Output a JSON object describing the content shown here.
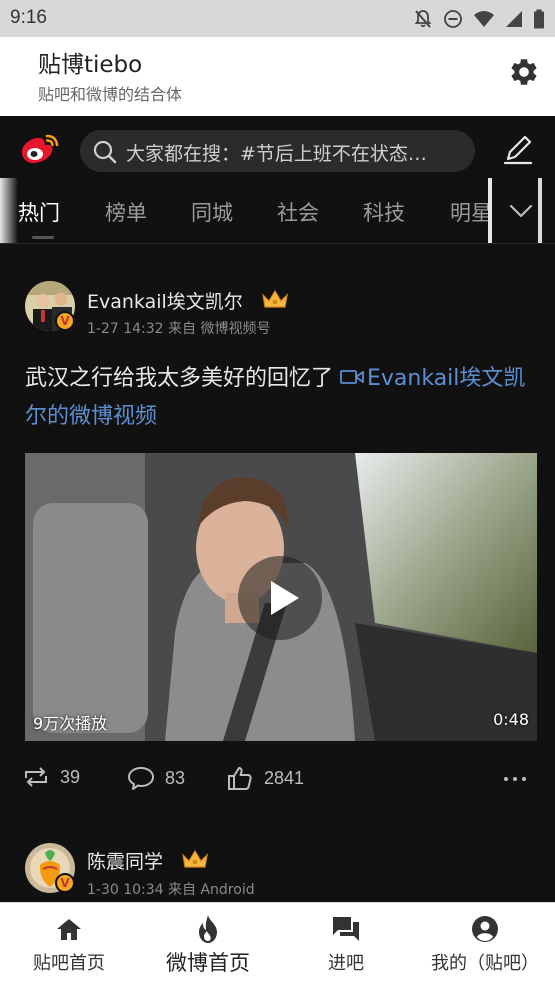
{
  "status_bar": {
    "time": "9:16",
    "icons": [
      "notifications-off-icon",
      "do-not-disturb-icon",
      "wifi-icon",
      "signal-icon",
      "battery-icon"
    ]
  },
  "app_header": {
    "title": "贴博tiebo",
    "subtitle": "贴吧和微博的结合体",
    "settings_icon": "gear-icon"
  },
  "weibo_bar": {
    "logo_icon": "weibo-logo-icon",
    "search_text": "大家都在搜：#节后上班不在状态…",
    "compose_icon": "compose-icon"
  },
  "tabs": {
    "items": [
      {
        "label": "热门",
        "active": true
      },
      {
        "label": "榜单",
        "active": false
      },
      {
        "label": "同城",
        "active": false
      },
      {
        "label": "社会",
        "active": false
      },
      {
        "label": "科技",
        "active": false
      },
      {
        "label": "明星",
        "active": false
      }
    ],
    "more_icon": "chevron-down-icon"
  },
  "posts": [
    {
      "author": "Evankail埃文凯尔",
      "meta": "1-27 14:32 来自 微博视频号",
      "text": "武汉之行给我太多美好的回忆了 ",
      "link_text": "Evankail埃文凯尔的微博视频",
      "video": {
        "play_count": "9万次播放",
        "duration": "0:48"
      },
      "actions": {
        "reposts": "39",
        "comments": "83",
        "likes": "2841"
      }
    },
    {
      "author": "陈震同学",
      "meta": "1-30 10:34 来自 Android"
    }
  ],
  "bottom_nav": {
    "items": [
      {
        "label": "贴吧首页",
        "icon": "home-icon",
        "active": false
      },
      {
        "label": "微博首页",
        "icon": "flame-icon",
        "active": true
      },
      {
        "label": "进吧",
        "icon": "chat-icon",
        "active": false
      },
      {
        "label": "我的（贴吧）",
        "icon": "account-icon",
        "active": false
      }
    ]
  },
  "colors": {
    "background": "#111111",
    "link": "#5b8fd1",
    "weibo_red": "#e6162d",
    "verified_badge": "#f5a623"
  }
}
